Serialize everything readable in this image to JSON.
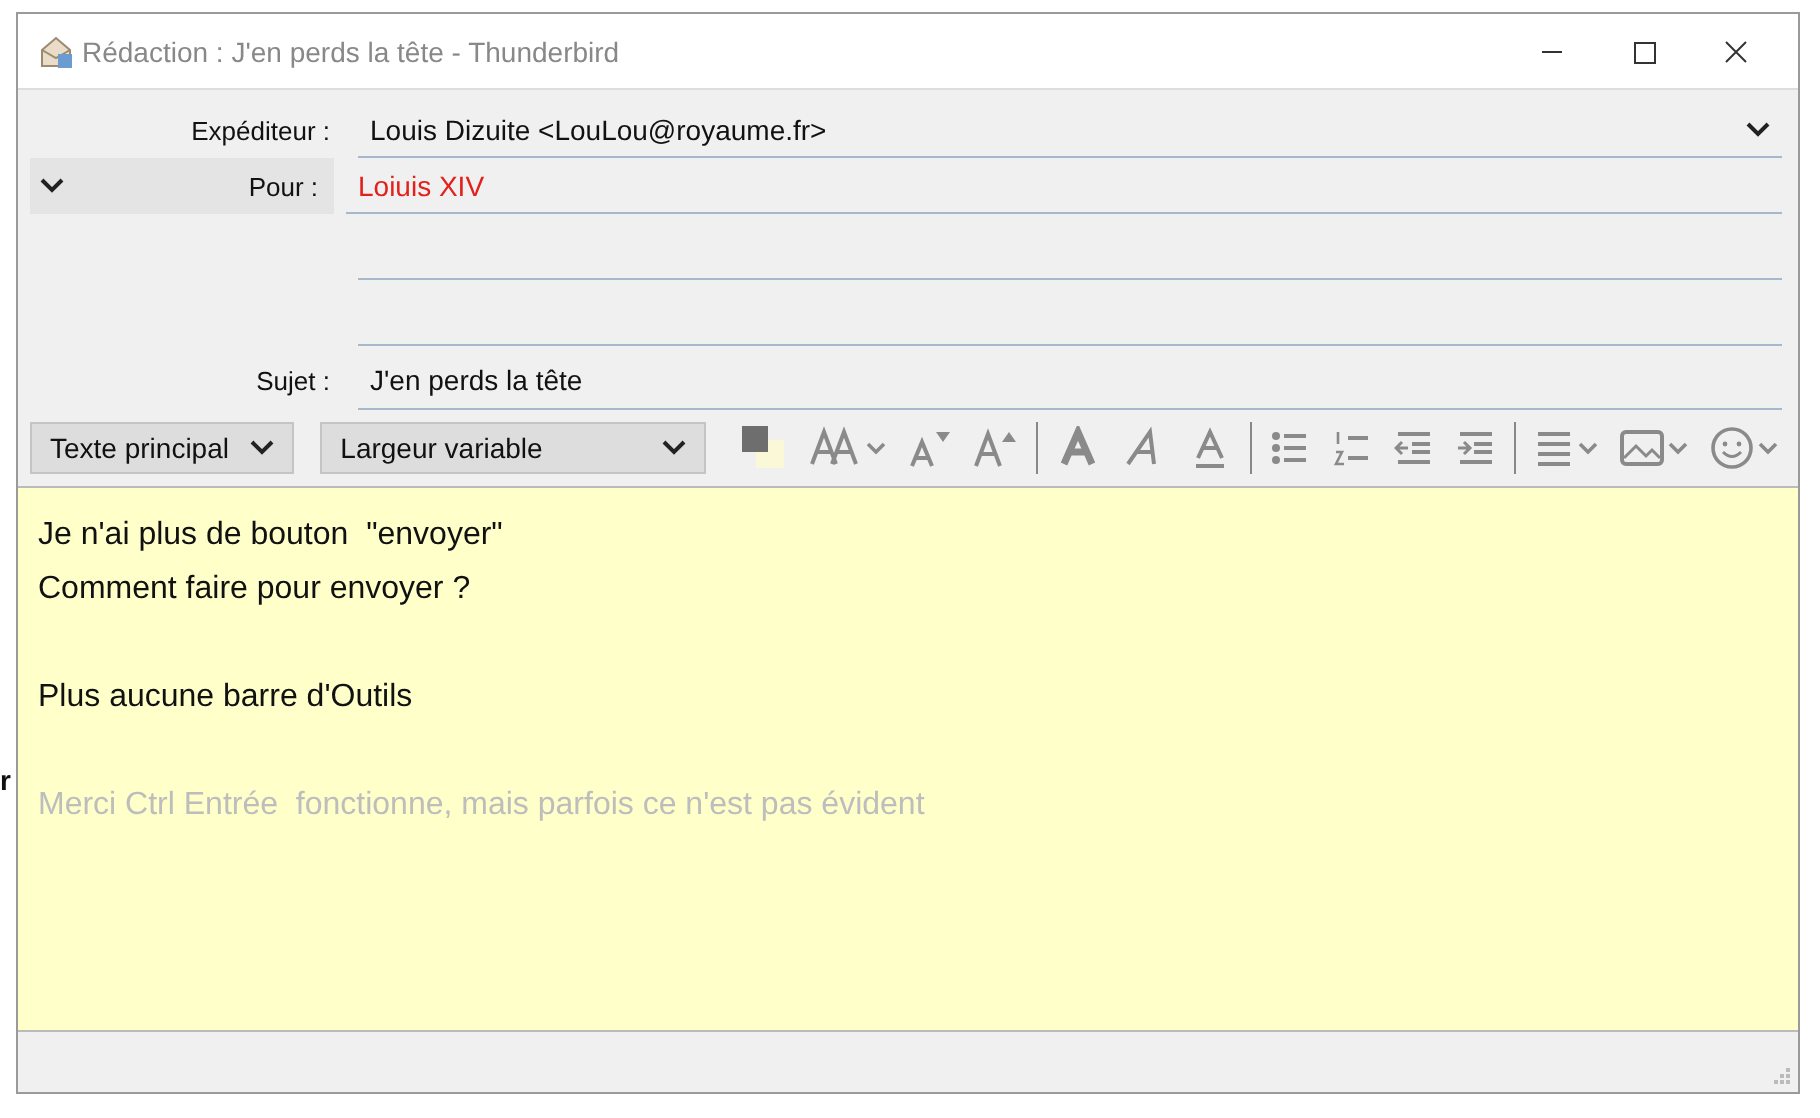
{
  "background": {
    "fragment": "r"
  },
  "window": {
    "title": "Rédaction : J'en perds la tête - Thunderbird"
  },
  "header": {
    "from_label": "Expéditeur :",
    "from_value": "Louis Dizuite <LouLou@royaume.fr>",
    "to_label": "Pour :",
    "recipients": [
      "Loiuis XIV"
    ],
    "empty_recipient_rows": [
      {
        "kind": "blank"
      },
      {
        "kind": "blank"
      }
    ],
    "subject_label": "Sujet :",
    "subject_value": "J'en perds la tête"
  },
  "toolbar": {
    "paragraph_format": "Texte principal",
    "font": "Largeur variable",
    "groups": [
      [
        {
          "kind": "colors",
          "dropdown": false
        },
        {
          "kind": "font-size",
          "dropdown": true
        },
        {
          "kind": "smaller",
          "dropdown": false
        },
        {
          "kind": "larger",
          "dropdown": false
        }
      ],
      [
        {
          "kind": "bold",
          "dropdown": false
        },
        {
          "kind": "italic",
          "dropdown": false
        },
        {
          "kind": "underline",
          "dropdown": false
        }
      ],
      [
        {
          "kind": "bullets",
          "dropdown": false
        },
        {
          "kind": "numbers",
          "dropdown": false
        },
        {
          "kind": "outdent",
          "dropdown": false
        },
        {
          "kind": "indent",
          "dropdown": false
        }
      ],
      [
        {
          "kind": "align",
          "dropdown": true
        },
        {
          "kind": "image",
          "dropdown": true
        },
        {
          "kind": "smiley",
          "dropdown": true
        }
      ]
    ]
  },
  "body": [
    {
      "kind": "line",
      "text": "Je n'ai plus de bouton  \"envoyer\""
    },
    {
      "kind": "line",
      "text": "Comment faire pour envoyer ?"
    },
    {
      "kind": "blank"
    },
    {
      "kind": "line",
      "text": "Plus aucune barre d'Outils"
    },
    {
      "kind": "blank"
    },
    {
      "kind": "hint",
      "text": "Merci Ctrl Entrée  fonctionne, mais parfois ce n'est pas évident"
    }
  ]
}
